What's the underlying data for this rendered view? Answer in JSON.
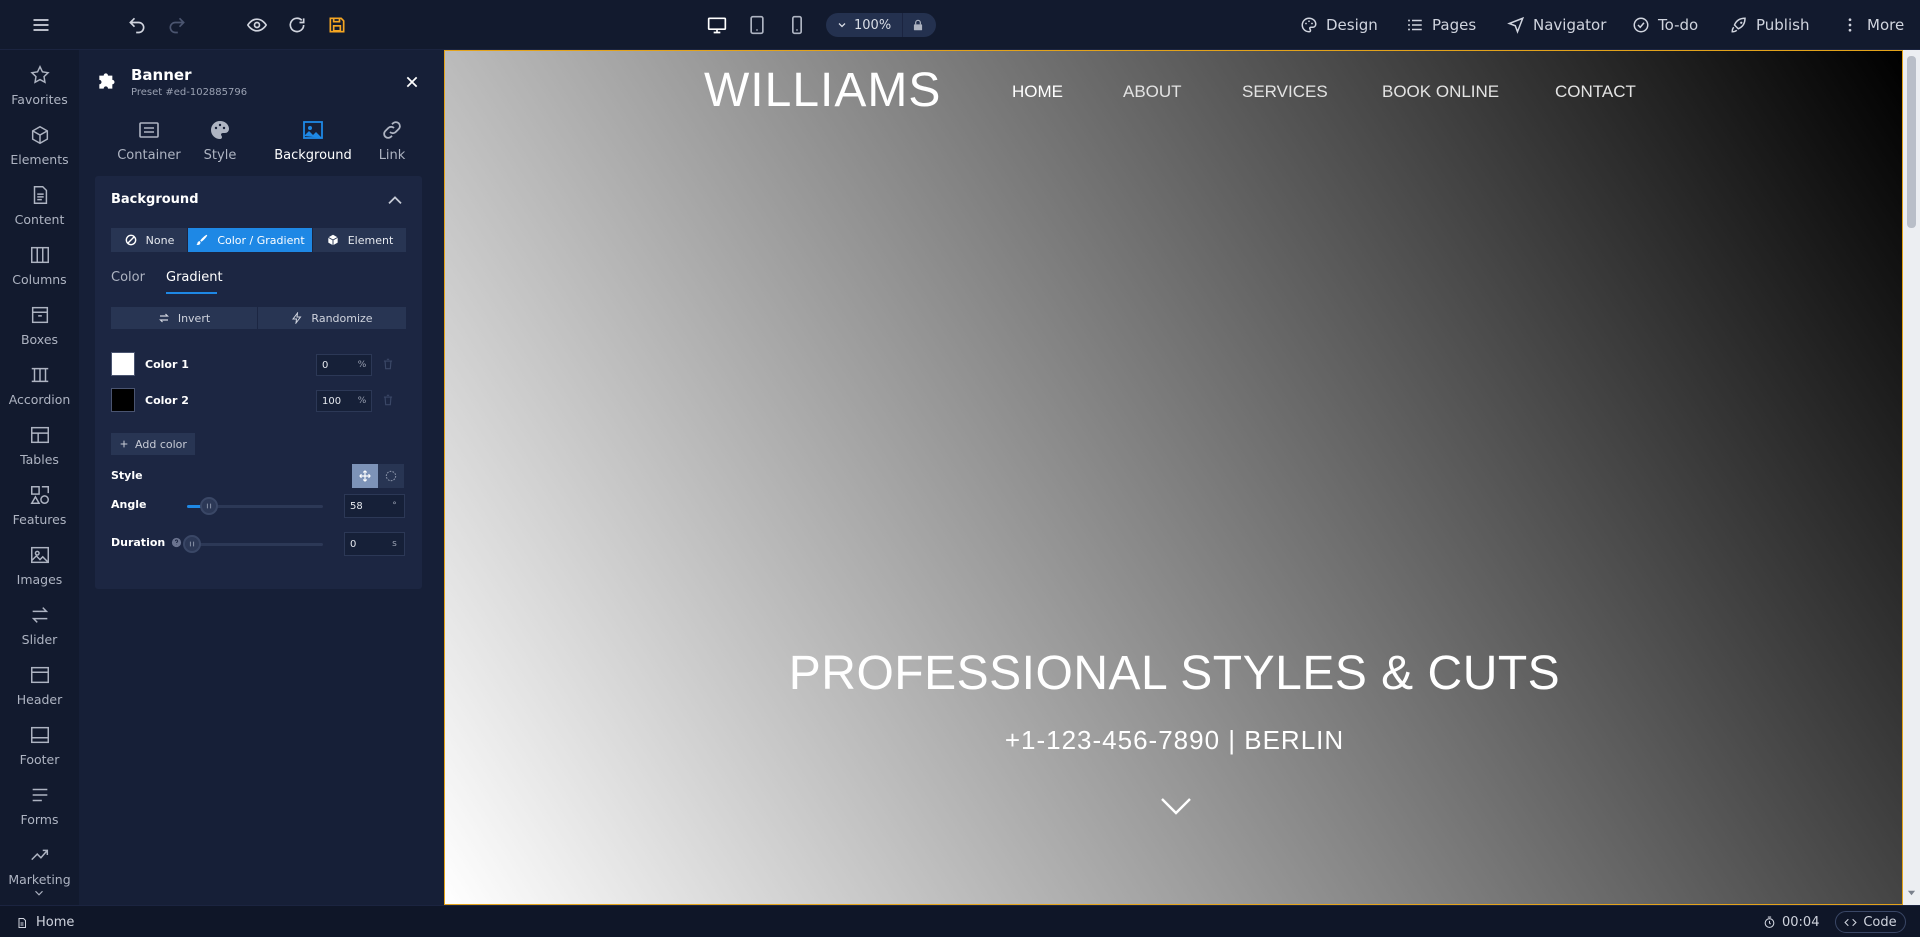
{
  "toolbar": {
    "zoom": "100%",
    "menu": {
      "design": "Design",
      "pages": "Pages",
      "navigator": "Navigator",
      "todo": "To-do",
      "publish": "Publish",
      "more": "More"
    }
  },
  "rail": {
    "items": [
      "Favorites",
      "Elements",
      "Content",
      "Columns",
      "Boxes",
      "Accordion",
      "Tables",
      "Features",
      "Images",
      "Slider",
      "Header",
      "Footer",
      "Forms",
      "Marketing"
    ]
  },
  "panel": {
    "title": "Banner",
    "subtitle": "Preset #ed-102885796",
    "tabs": [
      "Container",
      "Style",
      "Background",
      "Link"
    ],
    "active_tab": "Background",
    "section_title": "Background",
    "bg_types": [
      "None",
      "Color / Gradient",
      "Element"
    ],
    "sub_tabs": [
      "Color",
      "Gradient"
    ],
    "invert_label": "Invert",
    "randomize_label": "Randomize",
    "colors": [
      {
        "label": "Color 1",
        "swatch": "#ffffff",
        "position": "0",
        "unit": "%"
      },
      {
        "label": "Color 2",
        "swatch": "#000000",
        "position": "100",
        "unit": "%"
      }
    ],
    "add_color_label": "Add color",
    "style_label": "Style",
    "angle": {
      "label": "Angle",
      "value": "58",
      "unit": "°",
      "fraction": 0.16
    },
    "duration": {
      "label": "Duration",
      "value": "0",
      "unit": "s",
      "fraction": 0
    }
  },
  "site": {
    "logo": "WILLIAMS",
    "nav": [
      "HOME",
      "ABOUT",
      "SERVICES",
      "BOOK ONLINE",
      "CONTACT"
    ],
    "hero_title": "PROFESSIONAL STYLES & CUTS",
    "hero_subtitle": "+1-123-456-7890 | BERLIN",
    "gradient": {
      "angle_deg": 58,
      "from": "#ffffff",
      "to": "#000000"
    }
  },
  "statusbar": {
    "page": "Home",
    "timer": "00:04",
    "code_label": "Code"
  },
  "colors": {
    "accent": "#1e88e5",
    "save_icon": "#f5a623",
    "frame_outline": "#e3a31b"
  }
}
